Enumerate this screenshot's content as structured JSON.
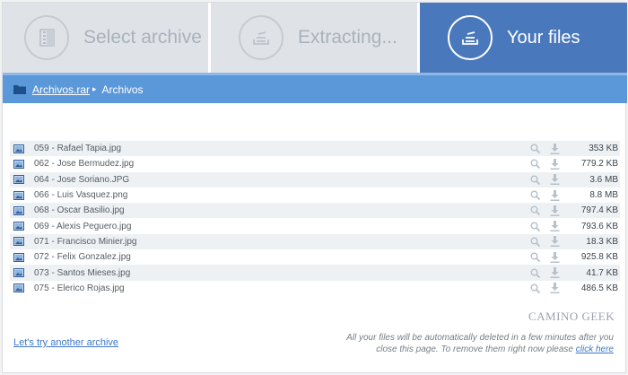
{
  "steps": [
    {
      "label": "Select archive",
      "icon": "archive-icon",
      "state": "done"
    },
    {
      "label": "Extracting...",
      "icon": "extract-icon",
      "state": "done"
    },
    {
      "label": "Your files",
      "icon": "tray-icon",
      "state": "active"
    }
  ],
  "breadcrumb": {
    "root": "Archivos.rar",
    "current": "Archivos"
  },
  "files": [
    {
      "name": "059 - Rafael Tapia.jpg",
      "size": "353 KB"
    },
    {
      "name": "062 - Jose Bermudez.jpg",
      "size": "779.2 KB"
    },
    {
      "name": "064 - Jose Soriano.JPG",
      "size": "3.6 MB"
    },
    {
      "name": "066 - Luis Vasquez.png",
      "size": "8.8 MB"
    },
    {
      "name": "068 - Oscar Basilio.jpg",
      "size": "797.4 KB"
    },
    {
      "name": "069 - Alexis Peguero.jpg",
      "size": "793.6 KB"
    },
    {
      "name": "071 - Francisco Minier.jpg",
      "size": "18.3 KB"
    },
    {
      "name": "072 - Felix Gonzalez.jpg",
      "size": "925.8 KB"
    },
    {
      "name": "073 - Santos Mieses.jpg",
      "size": "41.7 KB"
    },
    {
      "name": "075 - Elerico Rojas.jpg",
      "size": "486.5 KB"
    }
  ],
  "footer": {
    "try_link": "Let's try another archive",
    "watermark": "CAMINO GEEK",
    "notice_text": "All your files will be automatically deleted in a few minutes after you close this page. To remove them right now please",
    "notice_link": "click here"
  },
  "colors": {
    "active_step": "#4a78bd",
    "inactive_step": "#dfe3e8",
    "breadcrumb_bar": "#5b98d9",
    "link": "#3d78c8"
  }
}
